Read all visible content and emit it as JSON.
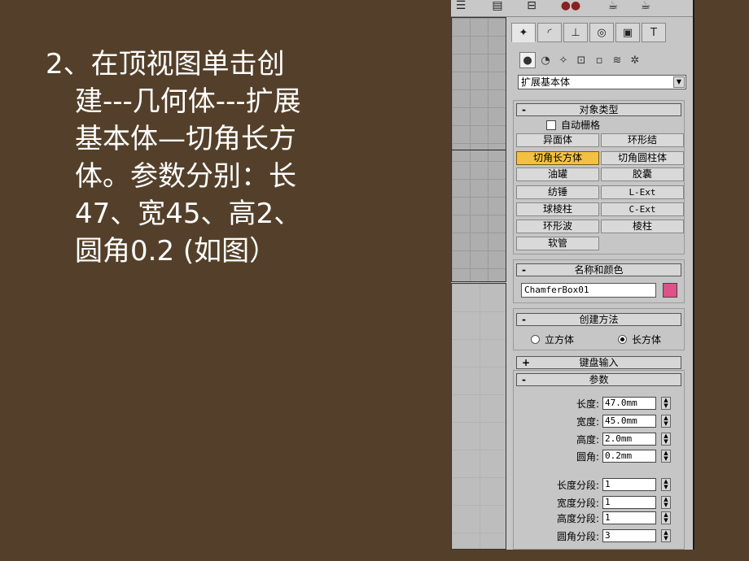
{
  "slide": {
    "lines": [
      "2、在顶视图单击创",
      "建---几何体---扩展",
      "基本体—切角长方",
      "体。参数分别：长",
      "47、宽45、高2、",
      "圆角0.2  (如图）"
    ]
  },
  "panel": {
    "category_dropdown": "扩展基本体",
    "object_type": {
      "title": "对象类型",
      "autogrid_label": "自动栅格",
      "buttons": [
        "异面体",
        "环形结",
        "切角长方体",
        "切角圆柱体",
        "油罐",
        "胶囊",
        "纺锤",
        "L-Ext",
        "球棱柱",
        "C-Ext",
        "环形波",
        "棱柱",
        "软管"
      ],
      "active_button": "切角长方体"
    },
    "name_color": {
      "title": "名称和颜色",
      "name_value": "ChamferBox01",
      "color": "#e0508a"
    },
    "creation_method": {
      "title": "创建方法",
      "option_cube": "立方体",
      "option_box": "长方体",
      "selected": "长方体"
    },
    "keyboard_entry": {
      "title": "键盘输入"
    },
    "parameters": {
      "title": "参数",
      "length_label": "长度:",
      "length_value": "47.0mm",
      "width_label": "宽度:",
      "width_value": "45.0mm",
      "height_label": "高度:",
      "height_value": "2.0mm",
      "fillet_label": "圆角:",
      "fillet_value": "0.2mm",
      "length_segs_label": "长度分段:",
      "length_segs_value": "1",
      "width_segs_label": "宽度分段:",
      "width_segs_value": "1",
      "height_segs_label": "高度分段:",
      "height_segs_value": "1",
      "fillet_segs_label": "圆角分段:",
      "fillet_segs_value": "3"
    }
  },
  "icons": {
    "toolbar": [
      "layers-icon",
      "table-icon",
      "render-icon",
      "material-icon",
      "teapot-icon",
      "teapot-icon"
    ],
    "command_tabs": [
      "create-icon",
      "modify-icon",
      "hierarchy-icon",
      "motion-icon",
      "display-icon",
      "utilities-icon"
    ],
    "create_sub": [
      "geometry-icon",
      "shapes-icon",
      "lights-icon",
      "cameras-icon",
      "helpers-icon",
      "spacewarps-icon",
      "systems-icon"
    ]
  }
}
